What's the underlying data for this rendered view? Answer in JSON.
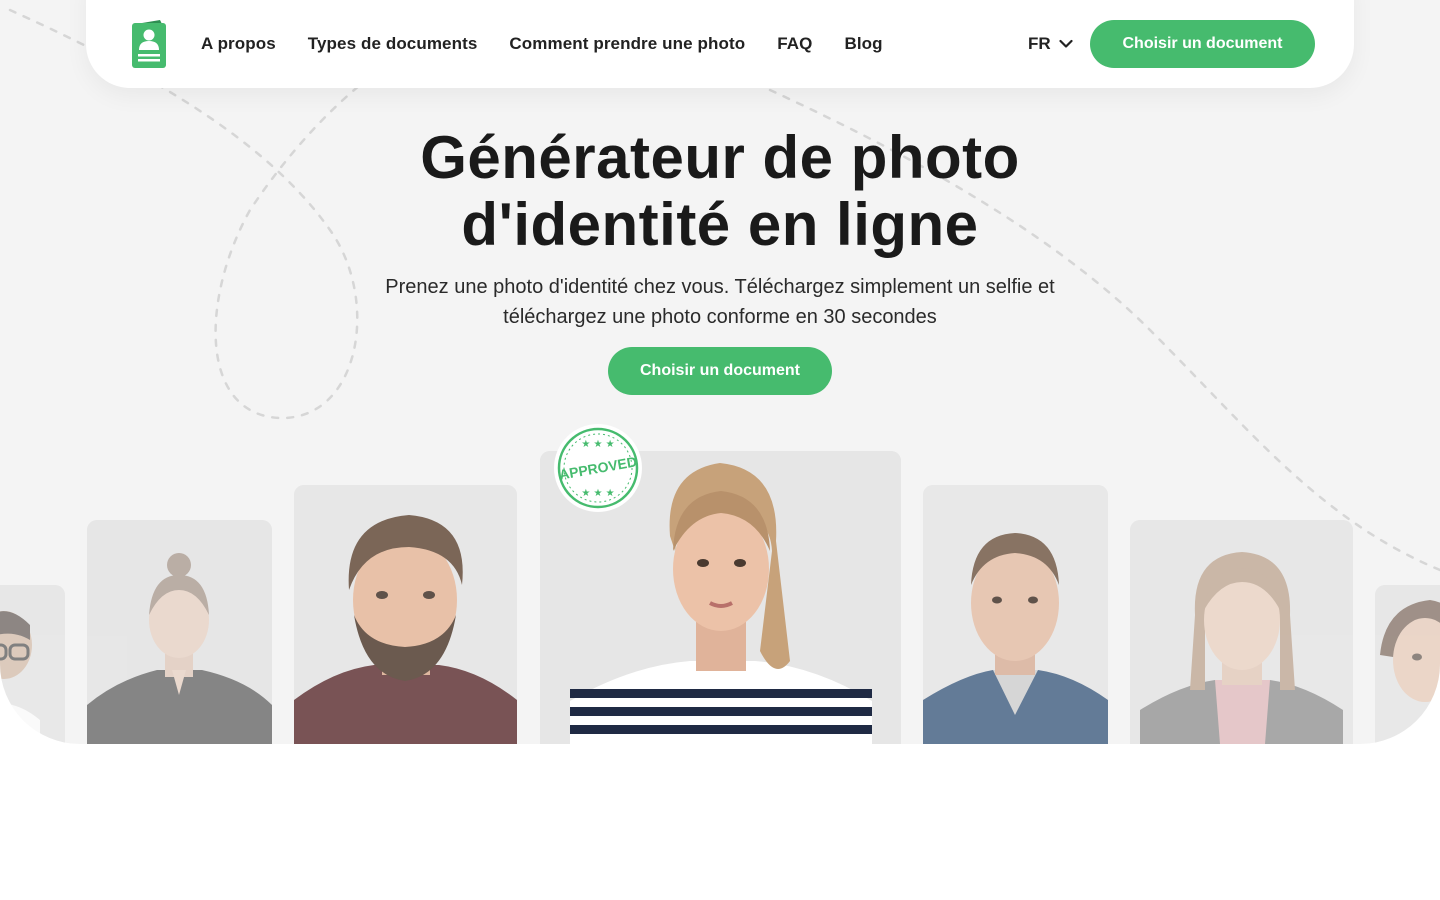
{
  "header": {
    "logo_icon": "id-card-icon",
    "nav": [
      {
        "label": "A propos"
      },
      {
        "label": "Types de documents"
      },
      {
        "label": "Comment prendre une photo"
      },
      {
        "label": "FAQ"
      },
      {
        "label": "Blog"
      }
    ],
    "language": "FR",
    "cta_label": "Choisir un document"
  },
  "hero": {
    "title_line1": "Générateur de photo",
    "title_line2": "d'identité en ligne",
    "subtitle_line1": "Prenez une photo d'identité chez vous. Téléchargez simplement un selfie et",
    "subtitle_line2": "téléchargez une photo conforme en 30 secondes",
    "cta_label": "Choisir un document"
  },
  "stamp": {
    "text": "APPROVED"
  },
  "colors": {
    "accent": "#46bb6e",
    "background": "#f4f4f4"
  }
}
